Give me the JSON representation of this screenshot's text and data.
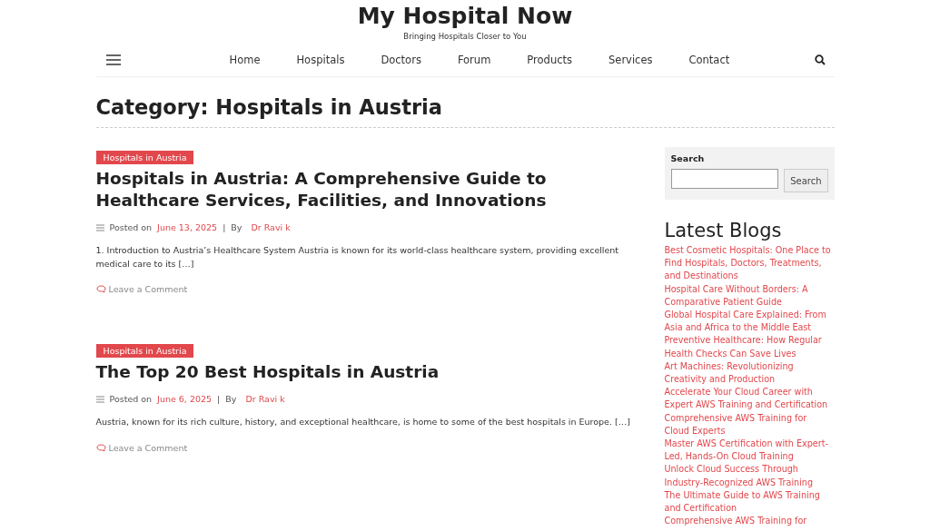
{
  "site": {
    "title": "My Hospital Now",
    "tagline": "Bringing Hospitals Closer to You"
  },
  "nav": [
    "Home",
    "Hospitals",
    "Doctors",
    "Forum",
    "Products",
    "Services",
    "Contact"
  ],
  "page_title": "Category: Hospitals in Austria",
  "posts": [
    {
      "category": "Hospitals in Austria",
      "title": "Hospitals in Austria: A Comprehensive Guide to Healthcare Services, Facilities, and Innovations",
      "posted_label": "Posted on",
      "date": "June 13, 2025",
      "separator": "|",
      "by_label": "By",
      "author": "Dr Ravi k",
      "excerpt": "1. Introduction to Austria’s Healthcare System Austria is known for its world-class healthcare system, providing excellent medical care to its […]",
      "comment_link": "Leave a Comment"
    },
    {
      "category": "Hospitals in Austria",
      "title": "The Top 20 Best Hospitals in Austria",
      "posted_label": "Posted on",
      "date": "June 6, 2025",
      "separator": "|",
      "by_label": "By",
      "author": "Dr Ravi k",
      "excerpt": "Austria, known for its rich culture, history, and exceptional healthcare, is home to some of the best hospitals in Europe. […]",
      "comment_link": "Leave a Comment"
    }
  ],
  "sidebar": {
    "search": {
      "label": "Search",
      "button": "Search"
    },
    "latest_blogs": {
      "heading": "Latest Blogs",
      "items": [
        "Best Cosmetic Hospitals: One Place to Find Hospitals, Doctors, Treatments, and Destinations",
        "Hospital Care Without Borders: A Comparative Patient Guide",
        "Global Hospital Care Explained: From Asia and Africa to the Middle East",
        "Preventive Healthcare: How Regular Health Checks Can Save Lives",
        "Art Machines: Revolutionizing Creativity and Production",
        "Accelerate Your Cloud Career with Expert AWS Training and Certification",
        "Comprehensive AWS Training for Cloud Experts",
        "Master AWS Certification with Expert-Led, Hands-On Cloud Training",
        "Unlock Cloud Success Through Industry-Recognized AWS Training",
        "The Ultimate Guide to AWS Training and Certification",
        "Comprehensive AWS Training for"
      ]
    }
  }
}
